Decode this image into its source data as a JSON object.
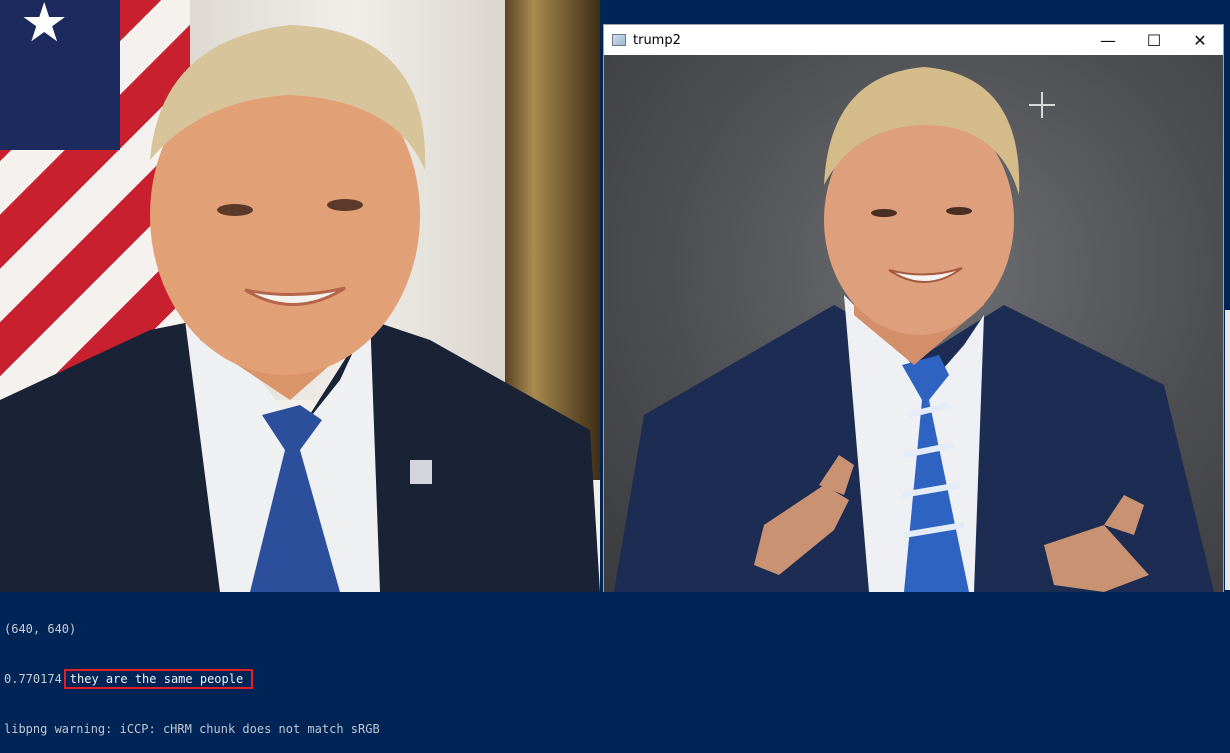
{
  "left_image": {
    "alt": "Portrait of man in navy suit with blue patterned tie in front of American flag"
  },
  "window": {
    "title": "trump2",
    "controls": {
      "minimize": "—",
      "maximize": "☐",
      "close": "✕"
    },
    "image_alt": "Man in navy suit with blue striped tie pointing both fingers toward viewer on grey background"
  },
  "console": {
    "line1": "(640, 640)",
    "line2_score": "0.770174",
    "line2_message": "they are the same people",
    "line3": "libpng warning: iCCP: cHRM chunk does not match sRGB"
  },
  "colors": {
    "terminal_bg": "#012456",
    "highlight_border": "#e21f26"
  }
}
